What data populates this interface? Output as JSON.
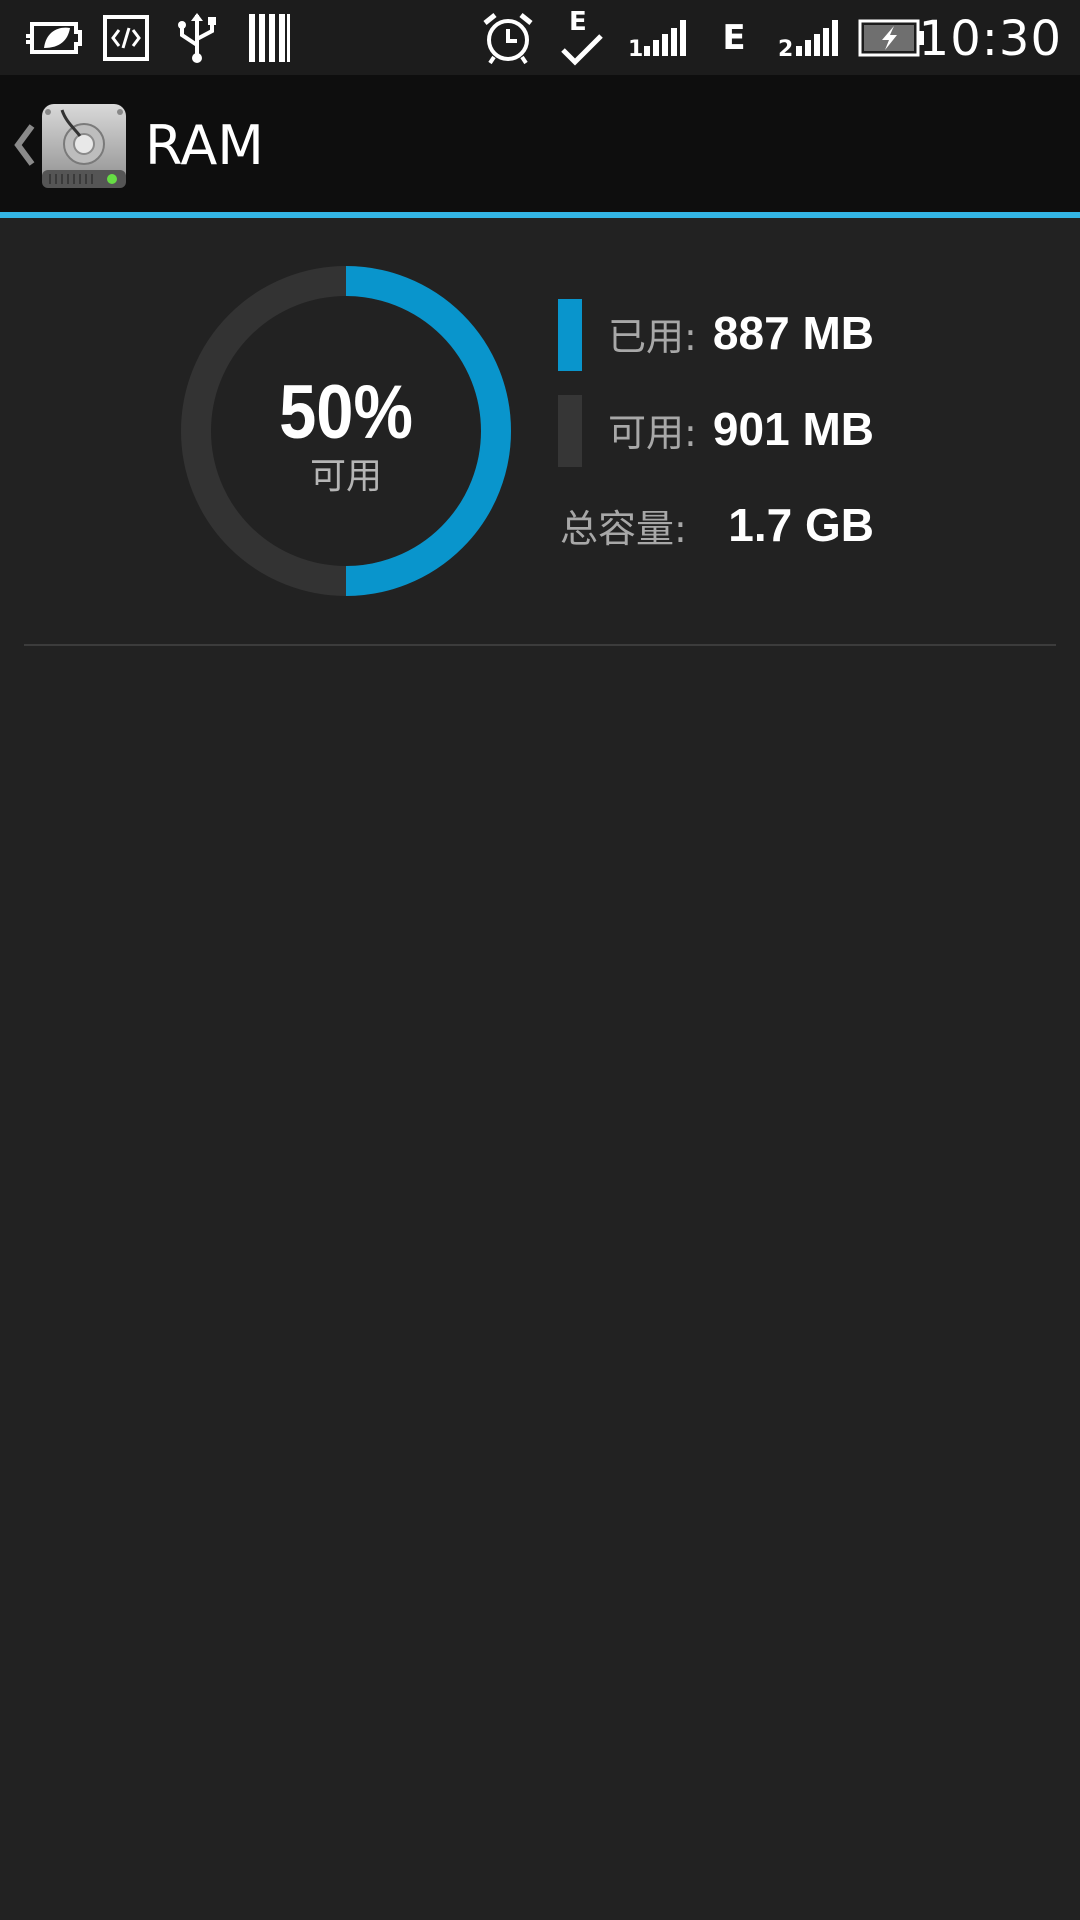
{
  "status_bar": {
    "time": "10:30",
    "icons": [
      "power-saver-icon",
      "developer-code-icon",
      "usb-icon",
      "barcode-icon",
      "alarm-icon",
      "sync-check-icon",
      "sim1-signal-icon",
      "edge-icon",
      "sim2-signal-icon",
      "battery-charging-icon"
    ],
    "edge_label": "E",
    "sim1_label": "1",
    "sim2_label": "2"
  },
  "action_bar": {
    "title": "RAM",
    "icon": "hard-drive-stethoscope-icon",
    "accent_color": "#33b5e5"
  },
  "memory": {
    "percent_text": "50%",
    "percent_sub": "可用",
    "available_fraction": 0.5,
    "used_label": "已用:",
    "used_value": "887 MB",
    "free_label": "可用:",
    "free_value": "901 MB",
    "total_label": "总容量:",
    "total_value": "1.7 GB",
    "used_color": "#0995cc",
    "free_color": "#363636"
  }
}
